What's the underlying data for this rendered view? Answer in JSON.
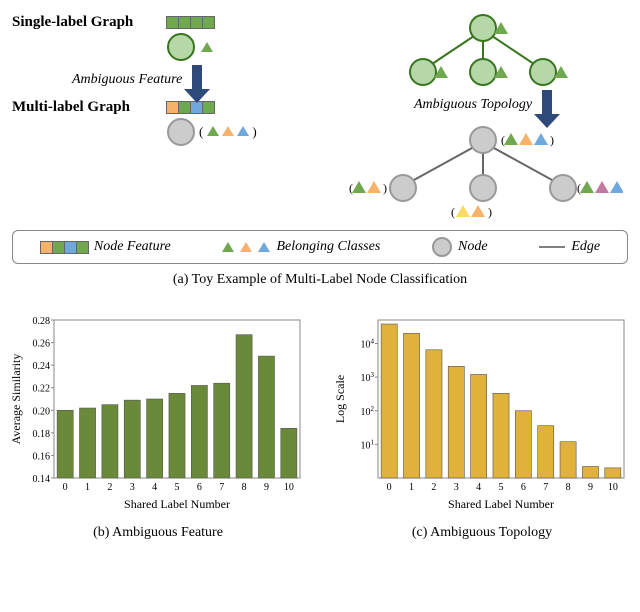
{
  "panel_a": {
    "single_label_title": "Single-label Graph",
    "multi_label_title": "Multi-label Graph",
    "ambiguous_feature": "Ambiguous Feature",
    "ambiguous_topology": "Ambiguous Topology",
    "caption": "(a)  Toy Example of Multi-Label Node Classification"
  },
  "legend": {
    "node_feature": "Node Feature",
    "belonging_classes": "Belonging Classes",
    "node": "Node",
    "edge": "Edge"
  },
  "colors": {
    "green": "#6fa84f",
    "green_light": "#b6d7a8",
    "green_stroke": "#38761d",
    "orange": "#f6b26b",
    "blue": "#6fa8dc",
    "gray": "#cccccc",
    "gray_stroke": "#999999",
    "magenta": "#c27ba0",
    "yellow": "#ffd966",
    "gold": "#e0b23b",
    "olive": "#6a8a3a"
  },
  "chart_data": [
    {
      "type": "bar",
      "title": "",
      "xlabel": "Shared Label Number",
      "ylabel": "Average Similarity",
      "categories": [
        "0",
        "1",
        "2",
        "3",
        "4",
        "5",
        "6",
        "7",
        "8",
        "9",
        "10"
      ],
      "values": [
        0.2,
        0.202,
        0.205,
        0.209,
        0.21,
        0.215,
        0.222,
        0.224,
        0.267,
        0.248,
        0.184
      ],
      "ylim": [
        0.14,
        0.28
      ],
      "yticks": [
        0.14,
        0.16,
        0.18,
        0.2,
        0.22,
        0.24,
        0.26,
        0.28
      ],
      "bar_color": "#6a8a3a",
      "caption": "(b)  Ambiguous Feature"
    },
    {
      "type": "bar",
      "title": "",
      "xlabel": "Shared Label Number",
      "ylabel": "Log Scale",
      "categories": [
        "0",
        "1",
        "2",
        "3",
        "4",
        "5",
        "6",
        "7",
        "8",
        "9",
        "10"
      ],
      "values": [
        38000,
        20000,
        6500,
        2100,
        1200,
        330,
        100,
        36,
        12,
        2.2,
        2.0
      ],
      "ylim_log": [
        1,
        50000
      ],
      "yticks_exp": [
        1,
        2,
        3,
        4
      ],
      "bar_color": "#e0b23b",
      "caption": "(c)  Ambiguous Topology"
    }
  ]
}
